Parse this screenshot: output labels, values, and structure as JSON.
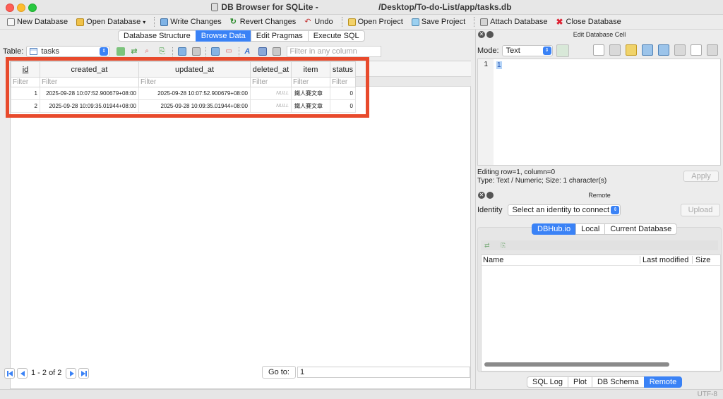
{
  "window": {
    "title_prefix": "DB Browser for SQLite - ",
    "title_path": "/Desktop/To-do-List/app/tasks.db"
  },
  "toolbar": {
    "new_database": "New Database",
    "open_database": "Open Database",
    "write_changes": "Write Changes",
    "revert_changes": "Revert Changes",
    "undo": "Undo",
    "open_project": "Open Project",
    "save_project": "Save Project",
    "attach_database": "Attach Database",
    "close_database": "Close Database"
  },
  "tabs": [
    "Database Structure",
    "Browse Data",
    "Edit Pragmas",
    "Execute SQL"
  ],
  "active_tab": "Browse Data",
  "browse": {
    "table_label": "Table:",
    "table_name": "tasks",
    "filter_any_placeholder": "Filter in any column",
    "filter_placeholder": "Filter",
    "columns": [
      "id",
      "created_at",
      "updated_at",
      "deleted_at",
      "item",
      "status"
    ],
    "rows": [
      [
        "1",
        "2025-09-28 10:07:52.900679+08:00",
        "2025-09-28 10:07:52.900679+08:00",
        "NULL",
        "鐵人賽文章",
        "0"
      ],
      [
        "2",
        "2025-09-28 10:09:35.01944+08:00",
        "2025-09-28 10:09:35.01944+08:00",
        "NULL",
        "鐵人賽文章",
        "0"
      ]
    ],
    "page_info": "1 - 2 of 2",
    "goto_label": "Go to:",
    "goto_value": "1"
  },
  "edit_cell": {
    "panel_title": "Edit Database Cell",
    "mode_label": "Mode:",
    "mode_value": "Text",
    "line_number": "1",
    "value": "1",
    "info_line1": "Editing row=1, column=0",
    "info_line2": "Type: Text / Numeric; Size: 1 character(s)",
    "apply": "Apply"
  },
  "remote": {
    "panel_title": "Remote",
    "identity_label": "Identity",
    "identity_value": "Select an identity to connect",
    "upload": "Upload",
    "tabs": [
      "DBHub.io",
      "Local",
      "Current Database"
    ],
    "active_tab": "DBHub.io",
    "columns": [
      "Name",
      "Last modified",
      "Size"
    ]
  },
  "bottom_tabs": [
    "SQL Log",
    "Plot",
    "DB Schema",
    "Remote"
  ],
  "bottom_active": "Remote",
  "status": {
    "encoding": "UTF-8"
  },
  "colors": {
    "accent": "#3a82f6",
    "highlight": "#e84a2c"
  }
}
